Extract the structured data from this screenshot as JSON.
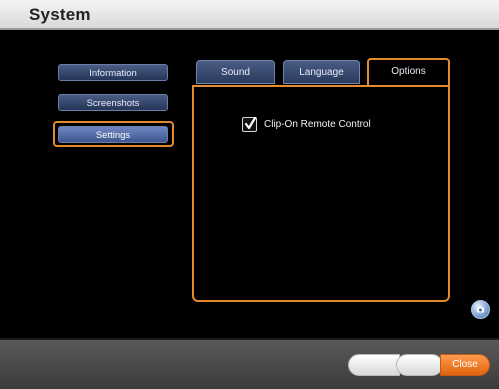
{
  "window": {
    "title": "System"
  },
  "sidebar": {
    "items": [
      {
        "label": "Information"
      },
      {
        "label": "Screenshots"
      },
      {
        "label": "Settings"
      }
    ]
  },
  "tabs": {
    "items": [
      {
        "label": "Sound"
      },
      {
        "label": "Language"
      },
      {
        "label": "Options"
      }
    ],
    "active": "Options"
  },
  "options_panel": {
    "clip_on_remote_control": {
      "label": "Clip-On Remote Control",
      "checked": true
    }
  },
  "footer": {
    "close_label": "Close"
  },
  "icons": {
    "camera": "camera-icon",
    "checkmark": "checkmark-icon"
  },
  "colors": {
    "accent": "#e48b2f",
    "nav_blue": "#3e568f",
    "close": "#e0640e"
  }
}
